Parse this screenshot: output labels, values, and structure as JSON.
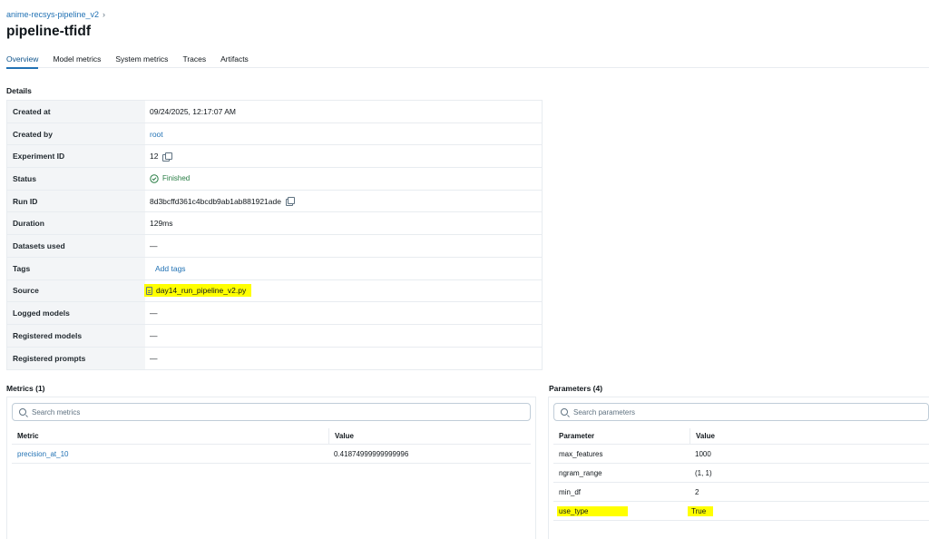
{
  "breadcrumb": {
    "experiment": "anime-recsys-pipeline_v2",
    "chevron": "›"
  },
  "page_title": "pipeline-tfidf",
  "tabs": [
    "Overview",
    "Model metrics",
    "System metrics",
    "Traces",
    "Artifacts"
  ],
  "active_tab": "Overview",
  "details": {
    "label": "Details",
    "rows": [
      {
        "key": "Created at",
        "value": "09/24/2025, 12:17:07 AM"
      },
      {
        "key": "Created by",
        "value": "root"
      },
      {
        "key": "Experiment ID",
        "value": "12"
      },
      {
        "key": "Status",
        "value": "Finished"
      },
      {
        "key": "Run ID",
        "value": "8d3bcffd361c4bcdb9ab1ab881921ade"
      },
      {
        "key": "Duration",
        "value": "129ms"
      },
      {
        "key": "Datasets used",
        "value": "—"
      },
      {
        "key": "Tags",
        "value": "Add tags"
      },
      {
        "key": "Source",
        "value": "day14_run_pipeline_v2.py"
      },
      {
        "key": "Logged models",
        "value": "—"
      },
      {
        "key": "Registered models",
        "value": "—"
      },
      {
        "key": "Registered prompts",
        "value": "—"
      }
    ]
  },
  "metrics": {
    "label": "Metrics (1)",
    "search_placeholder": "Search metrics",
    "columns": [
      "Metric",
      "Value"
    ],
    "rows": [
      {
        "name": "precision_at_10",
        "value": "0.41874999999999996"
      }
    ]
  },
  "parameters": {
    "label": "Parameters (4)",
    "search_placeholder": "Search parameters",
    "columns": [
      "Parameter",
      "Value"
    ],
    "rows": [
      {
        "name": "max_features",
        "value": "1000"
      },
      {
        "name": "ngram_range",
        "value": "(1, 1)"
      },
      {
        "name": "min_df",
        "value": "2"
      },
      {
        "name": "use_type",
        "value": "True"
      }
    ]
  },
  "colors": {
    "link": "#2272b4",
    "success": "#277c43",
    "highlight": "#ffff00"
  }
}
